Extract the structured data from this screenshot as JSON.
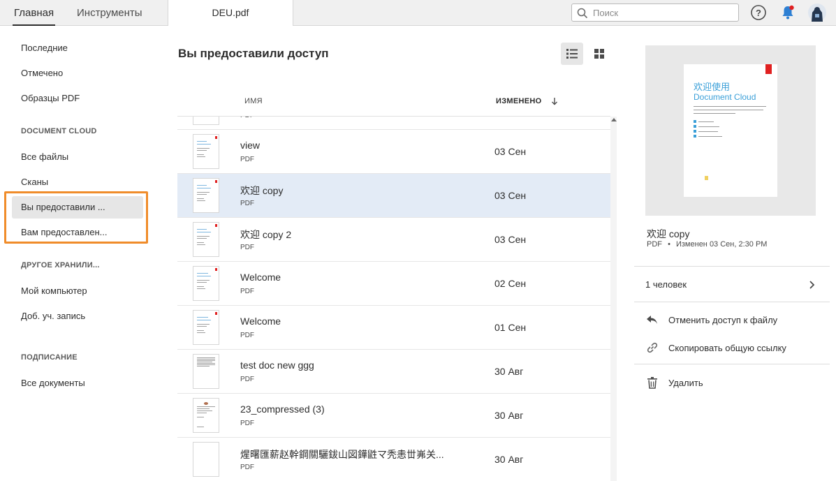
{
  "topbar": {
    "nav_home": "Главная",
    "nav_tools": "Инструменты",
    "doc_tab": "DEU.pdf",
    "search_placeholder": "Поиск"
  },
  "sidebar": {
    "items_top": [
      "Последние",
      "Отмечено",
      "Образцы PDF"
    ],
    "section_cloud": "DOCUMENT CLOUD",
    "items_cloud": [
      "Все файлы",
      "Сканы",
      "Вы предоставили ...",
      "Вам предоставлен..."
    ],
    "section_other": "ДРУГОЕ ХРАНИЛИ...",
    "items_other": [
      "Мой компьютер",
      "Доб. уч. запись"
    ],
    "section_sign": "ПОДПИСАНИЕ",
    "items_sign": [
      "Все документы"
    ]
  },
  "main": {
    "title": "Вы предоставили доступ",
    "col_name": "ИМЯ",
    "col_modified": "ИЗМЕНЕНО",
    "partial_type": "PDF",
    "rows": [
      {
        "name": "view",
        "type": "PDF",
        "date": "03 Сен",
        "thumb": "blue"
      },
      {
        "name": "欢迎 copy",
        "type": "PDF",
        "date": "03 Сен",
        "thumb": "blue"
      },
      {
        "name": "欢迎 copy 2",
        "type": "PDF",
        "date": "03 Сен",
        "thumb": "blue"
      },
      {
        "name": "Welcome",
        "type": "PDF",
        "date": "02 Сен",
        "thumb": "blue"
      },
      {
        "name": "Welcome",
        "type": "PDF",
        "date": "01 Сен",
        "thumb": "blue"
      },
      {
        "name": "test doc new ggg",
        "type": "PDF",
        "date": "30 Авг",
        "thumb": "text"
      },
      {
        "name": "23_compressed (3)",
        "type": "PDF",
        "date": "30 Авг",
        "thumb": "letter"
      },
      {
        "name": "煋曙匯薪赵幹鋼關驪鈸⼭図鏵鼪マ秃恚丗岪关...",
        "type": "PDF",
        "date": "30 Авг",
        "thumb": "blank"
      }
    ]
  },
  "detail": {
    "preview_title": "欢迎使用",
    "preview_subtitle": "Document Cloud",
    "name": "欢迎 copy",
    "type": "PDF",
    "modified": "Изменен 03 Сен, 2:30 PM",
    "people": "1 человек",
    "actions": {
      "unshare": "Отменить доступ к файлу",
      "copy_link": "Скопировать общую ссылку",
      "delete": "Удалить"
    }
  },
  "colors": {
    "accent_blue": "#3a9fd8",
    "highlight_orange": "#f08c2a",
    "selected_row": "#e3ebf6",
    "notification_red": "#e02020"
  }
}
